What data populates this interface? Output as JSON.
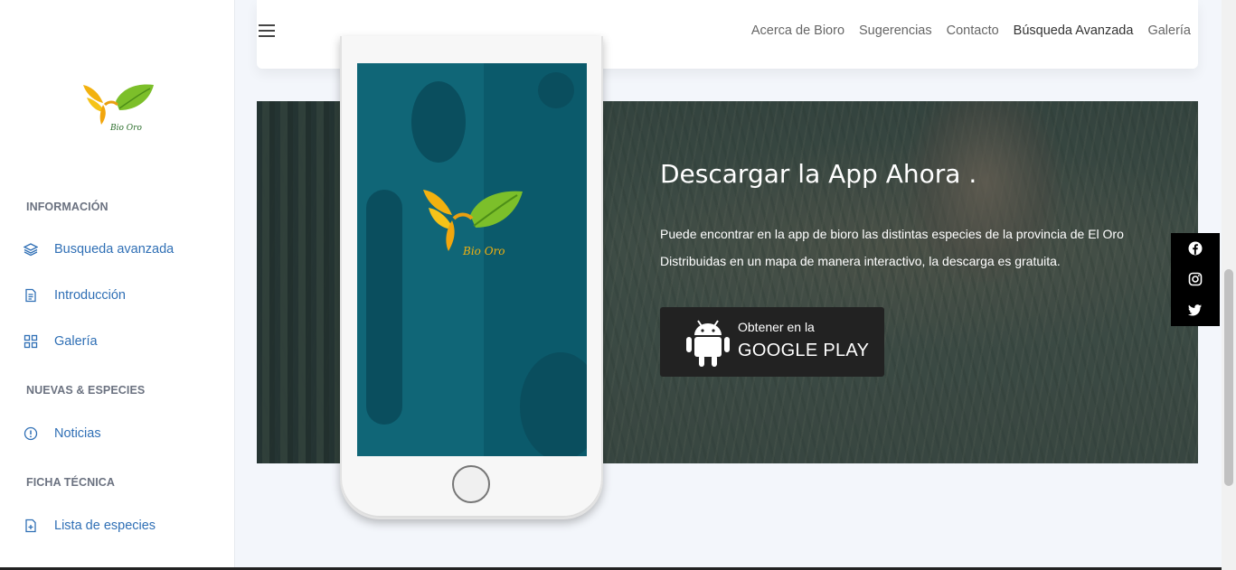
{
  "sidebar": {
    "logo_text": "Bio Oro",
    "sections": [
      {
        "title": "INFORMACIÓN"
      },
      {
        "title": "NUEVAS & ESPECIES"
      },
      {
        "title": "FICHA TÉCNICA"
      }
    ],
    "items": [
      {
        "label": "Busqueda avanzada",
        "icon": "layers-icon"
      },
      {
        "label": "Introducción",
        "icon": "document-icon"
      },
      {
        "label": "Galería",
        "icon": "grid-icon"
      },
      {
        "label": "Noticias",
        "icon": "info-circle-icon"
      },
      {
        "label": "Lista de especies",
        "icon": "file-plus-icon"
      }
    ]
  },
  "nav": {
    "items": [
      "Acerca de Bioro",
      "Sugerencias",
      "Contacto",
      "Búsqueda Avanzada",
      "Galería"
    ]
  },
  "promo": {
    "title": "Descargar la App Ahora .",
    "text": "Puede encontrar en la app de bioro las distintas especies de la provincia de El Oro Distribuidas en un mapa de manera interactivo, la descarga es gratuita.",
    "button_small": "Obtener en la",
    "button_big": "GOOGLE PLAY"
  },
  "phone": {
    "logo_text": "Bio Oro"
  },
  "social": [
    "facebook-icon",
    "instagram-icon",
    "twitter-icon"
  ],
  "colors": {
    "accent": "#2f6fb5",
    "banner_overlay": "#142832",
    "button_bg": "#222222",
    "social_bg": "#000000",
    "phone_screen": "#0b5a6b"
  }
}
